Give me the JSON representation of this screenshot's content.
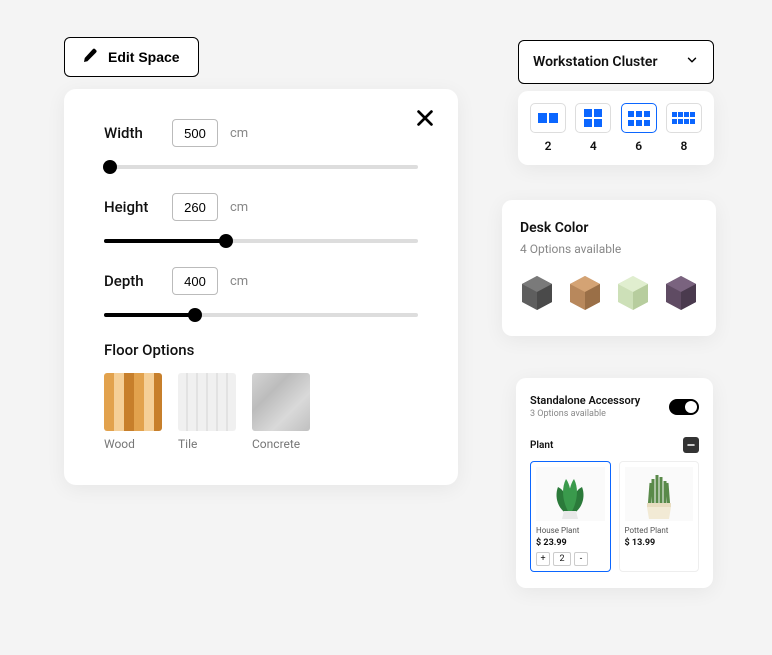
{
  "edit_space": {
    "button_label": "Edit Space",
    "width": {
      "label": "Width",
      "value": "500",
      "unit": "cm",
      "percent": 2
    },
    "height": {
      "label": "Height",
      "value": "260",
      "unit": "cm",
      "percent": 39
    },
    "depth": {
      "label": "Depth",
      "value": "400",
      "unit": "cm",
      "percent": 29
    },
    "floor": {
      "title": "Floor Options",
      "options": [
        {
          "name": "Wood"
        },
        {
          "name": "Tile"
        },
        {
          "name": "Concrete"
        }
      ]
    }
  },
  "cluster": {
    "label": "Workstation Cluster",
    "sizes": [
      "2",
      "4",
      "6",
      "8"
    ],
    "selected": "6"
  },
  "desk_color": {
    "title": "Desk Color",
    "subtitle": "4 Options available",
    "colors": [
      "#5e5e5e",
      "#b8885c",
      "#cde0b8",
      "#5f4b63"
    ]
  },
  "accessory": {
    "title": "Standalone Accessory",
    "subtitle": "3 Options available",
    "toggle_on": true,
    "group_label": "Plant",
    "items": [
      {
        "name": "House Plant",
        "price": "$ 23.99",
        "qty": "2",
        "selected": true
      },
      {
        "name": "Potted Plant",
        "price": "$ 13.99",
        "selected": false
      }
    ]
  }
}
